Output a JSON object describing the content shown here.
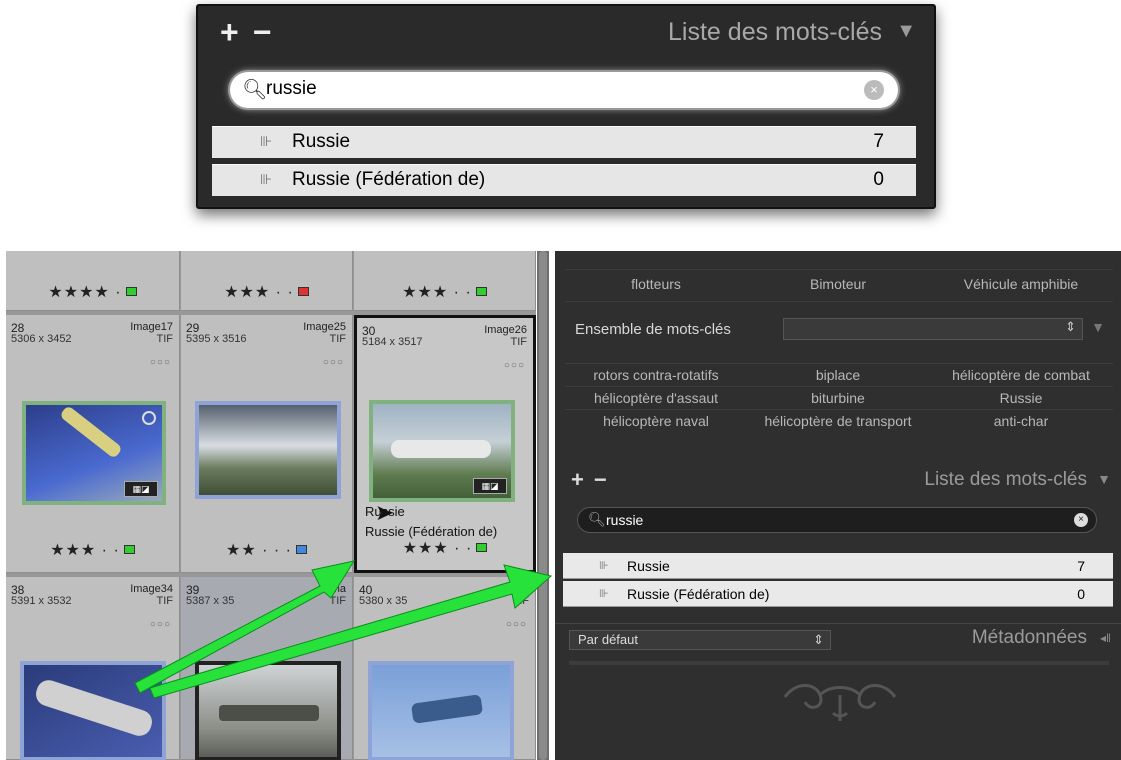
{
  "callout": {
    "plus": "+",
    "minus": "−",
    "title": "Liste des mots-clés",
    "search_value": "russie",
    "rows": [
      {
        "name": "Russie",
        "count": "7"
      },
      {
        "name": "Russie (Fédération de)",
        "count": "0"
      }
    ]
  },
  "grid": {
    "top_row_stars": [
      "★★★★ ·",
      "★★★ · ·",
      "★★★ · ·"
    ],
    "cells": [
      {
        "num": "28",
        "img": "Image17",
        "dim": "5306 x 3452",
        "ext": "TIF",
        "dots": "○○○",
        "stars": "★★★ · ·"
      },
      {
        "num": "29",
        "img": "Image25",
        "dim": "5395 x 3516",
        "ext": "TIF",
        "dots": "○○○",
        "stars": "★★ · · ·"
      },
      {
        "num": "30",
        "img": "Image26",
        "dim": "5184 x 3517",
        "ext": "TIF",
        "dots": "○○○",
        "stars": "★★★ · ·"
      },
      {
        "num": "38",
        "img": "Image34",
        "dim": "5391 x 3532",
        "ext": "TIF",
        "dots": "○○○",
        "stars": ""
      },
      {
        "num": "39",
        "img": "Ima",
        "dim": "5387 x 35",
        "ext": "TIF",
        "dots": "",
        "stars": ""
      },
      {
        "num": "40",
        "img": "Im",
        "dim": "5380 x 35",
        "ext": "TIF",
        "dots": "○○○",
        "stars": ""
      }
    ],
    "drag_tooltip": [
      "Russie",
      "Russie (Fédération de)"
    ]
  },
  "panel": {
    "top_keywords": [
      "flotteurs",
      "Bimoteur",
      "Véhicule amphibie"
    ],
    "ensemble_label": "Ensemble de mots-clés",
    "ensemble_keywords": [
      "rotors contra-rotatifs",
      "biplace",
      "hélicoptère de combat",
      "hélicoptère d'assaut",
      "biturbine",
      "Russie",
      "hélicoptère naval",
      "hélicoptère de transport",
      "anti-char"
    ],
    "lk_title": "Liste des mots-clés",
    "lk_search": "russie",
    "lk_rows": [
      {
        "name": "Russie",
        "count": "7"
      },
      {
        "name": "Russie (Fédération de)",
        "count": "0"
      }
    ],
    "meta_preset": "Par défaut",
    "meta_title": "Métadonnées"
  },
  "colors": {
    "arrow": "#22dd22",
    "panel_bg": "#2f2f2f",
    "grid_bg": "#bfbfbf"
  }
}
